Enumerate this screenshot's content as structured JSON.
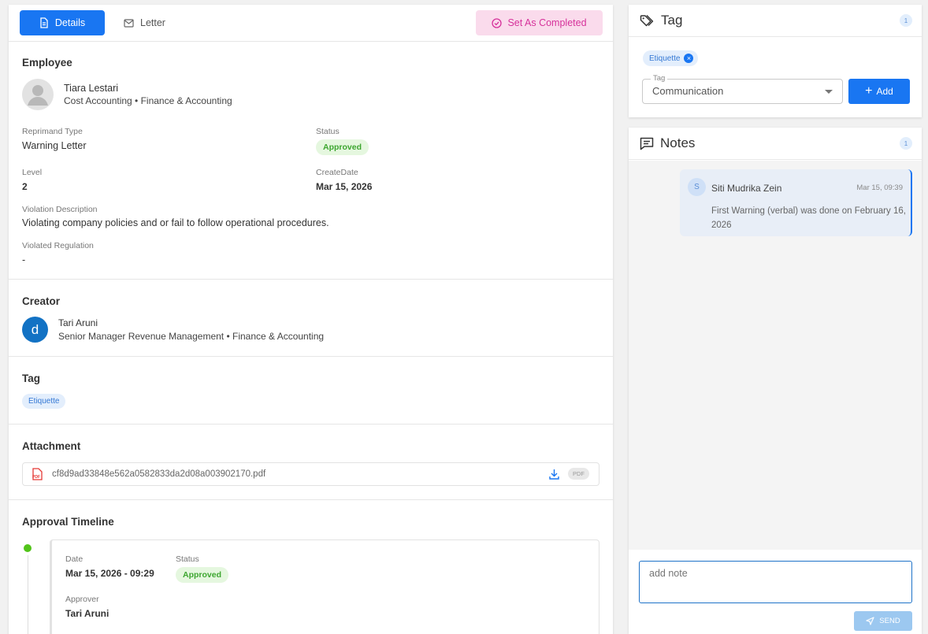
{
  "tabs": {
    "details": "Details",
    "letter": "Letter",
    "complete": "Set As Completed"
  },
  "employee": {
    "section_title": "Employee",
    "name": "Tiara Lestari",
    "position": "Cost Accounting • Finance & Accounting",
    "reprimand_type_label": "Reprimand Type",
    "reprimand_type": "Warning Letter",
    "status_label": "Status",
    "status": "Approved",
    "level_label": "Level",
    "level": "2",
    "create_date_label": "CreateDate",
    "create_date": "Mar 15, 2026",
    "violation_label": "Violation Description",
    "violation": "Violating company policies and or fail to follow operational procedures.",
    "regulation_label": "Violated Regulation",
    "regulation": "-"
  },
  "creator": {
    "section_title": "Creator",
    "avatar_letter": "d",
    "name": "Tari Aruni",
    "position": "Senior Manager Revenue Management • Finance & Accounting"
  },
  "tag_section": {
    "title": "Tag",
    "chip": "Etiquette"
  },
  "attachment": {
    "title": "Attachment",
    "file_icon_text": "PDF",
    "filename": "cf8d9ad33848e562a0582833da2d08a003902170.pdf",
    "type_badge": "PDF"
  },
  "timeline": {
    "title": "Approval Timeline",
    "date_label": "Date",
    "date": "Mar 15, 2026 - 09:29",
    "status_label": "Status",
    "status": "Approved",
    "approver_label": "Approver",
    "approver": "Tari Aruni"
  },
  "tag_panel": {
    "title": "Tag",
    "count": "1",
    "chip": "Etiquette",
    "select_label": "Tag",
    "select_value": "Communication",
    "add_label": "Add"
  },
  "notes_panel": {
    "title": "Notes",
    "count": "1",
    "note": {
      "avatar": "S",
      "author": "Siti Mudrika Zein",
      "time": "Mar 15, 09:39",
      "text": "First Warning (verbal) was done on February 16, 2026"
    },
    "input_placeholder": "add note",
    "send_label": "SEND"
  },
  "colors": {
    "primary": "#1976f2",
    "complete_bg": "#fadbec",
    "complete_text": "#d6329b",
    "approved_bg": "#e5f7df",
    "approved_text": "#3da630",
    "chip_bg": "#e3eefc",
    "avatar_creator": "#1272c4",
    "timeline_dot": "#52c41a",
    "send_bg": "#9cc8f0"
  }
}
